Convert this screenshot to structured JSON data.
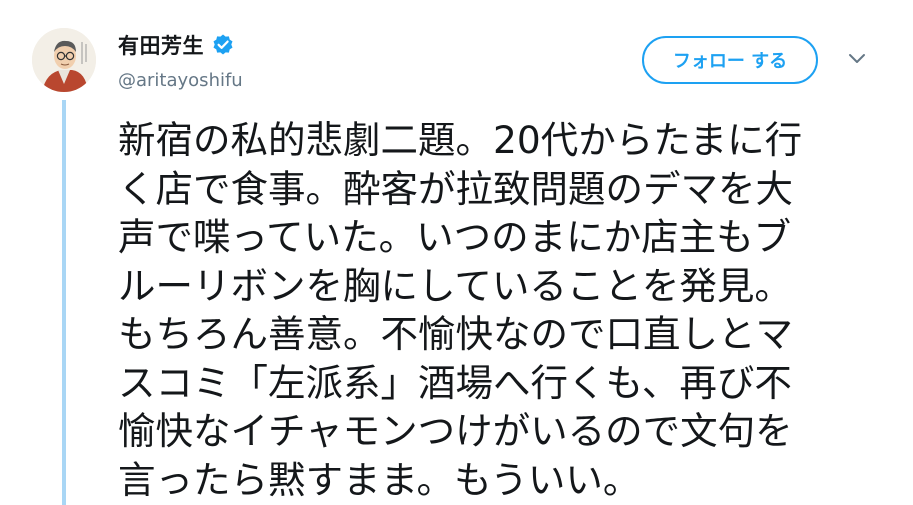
{
  "user": {
    "display_name": "有田芳生",
    "handle": "@aritayoshifu"
  },
  "follow_button": {
    "label": "フォロー する"
  },
  "icons": {
    "verified": "verified-badge-icon",
    "caret": "chevron-down-icon",
    "verified_color": "#1da1f2"
  },
  "tweet": {
    "lines": [
      "新宿の私的悲劇二題。20代からたまに行",
      "く店で食事。酔客が拉致問題のデマを大",
      "声で喋っていた。いつのまにか店主もブ",
      "ルーリボンを胸にしていることを発見。",
      "もちろん善意。不愉快なので口直しとマ",
      "スコミ「左派系」酒場へ行くも、再び不",
      "愉快なイチャモンつけがいるので文句を",
      "言ったら黙すまま。もういい。"
    ]
  }
}
